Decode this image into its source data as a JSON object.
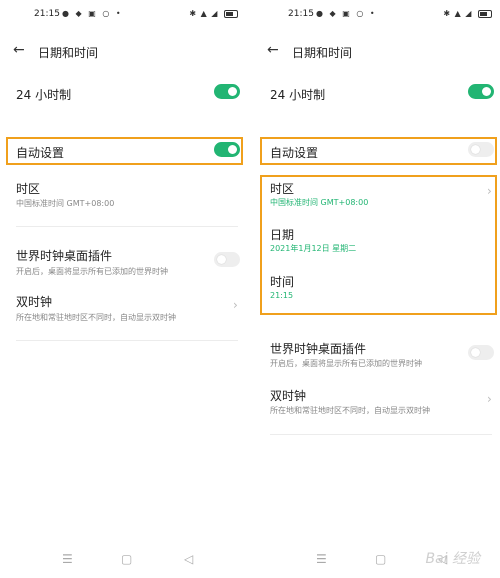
{
  "status": {
    "time": "21:15"
  },
  "nav": {
    "title": "日期和时间"
  },
  "left": {
    "r24": {
      "title": "24 小时制"
    },
    "auto": {
      "title": "自动设置"
    },
    "tz": {
      "title": "时区",
      "sub": "中国标准时间 GMT+08:00"
    },
    "wc": {
      "title": "世界时钟桌面插件",
      "sub": "开启后，桌面将显示所有已添加的世界时钟"
    },
    "dual": {
      "title": "双时钟",
      "sub": "所在地和常驻地时区不同时，自动显示双时钟"
    }
  },
  "right": {
    "r24": {
      "title": "24 小时制"
    },
    "auto": {
      "title": "自动设置"
    },
    "tz": {
      "title": "时区",
      "sub": "中国标准时间 GMT+08:00"
    },
    "date": {
      "title": "日期",
      "sub": "2021年1月12日 星期二"
    },
    "time": {
      "title": "时间",
      "sub": "21:15"
    },
    "wc": {
      "title": "世界时钟桌面插件",
      "sub": "开启后，桌面将显示所有已添加的世界时钟"
    },
    "dual": {
      "title": "双时钟",
      "sub": "所在地和常驻地时区不同时，自动显示双时钟"
    }
  },
  "watermark": "Bai 经验",
  "colors": {
    "accent": "#22b573",
    "highlight": "#f0a01c"
  }
}
